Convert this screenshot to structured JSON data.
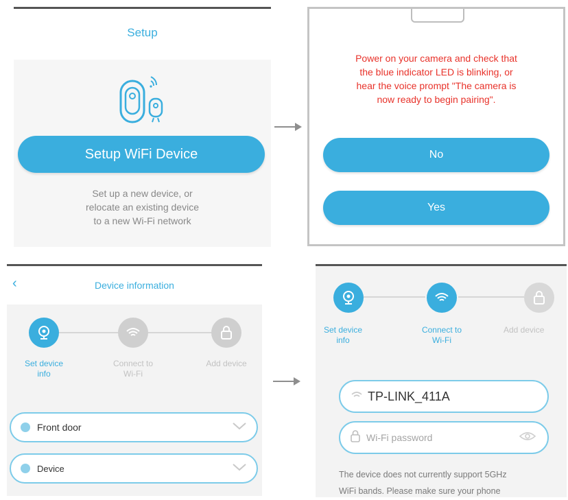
{
  "colors": {
    "accent": "#3aaede",
    "warning_text": "#e8322a",
    "step_inactive": "#cfcfcf"
  },
  "panel_setup": {
    "title": "Setup",
    "button_label": "Setup WiFi Device",
    "description_lines": [
      "Set up a new device, or",
      "relocate an existing device",
      "to a new Wi-Fi network"
    ],
    "icons": [
      "camera-icon",
      "wifi-signal-icon"
    ]
  },
  "panel_confirm": {
    "message_lines": [
      "Power on your camera and check that",
      "the blue indicator LED is blinking, or",
      "hear the voice prompt \"The camera is",
      "now ready to begin pairing\"."
    ],
    "no_label": "No",
    "yes_label": "Yes"
  },
  "panel_device_info": {
    "title": "Device information",
    "steps": [
      {
        "label_lines": [
          "Set device",
          "info"
        ],
        "icon": "camera-icon"
      },
      {
        "label_lines": [
          "Connect to",
          "Wi-Fi"
        ],
        "icon": "wifi-icon"
      },
      {
        "label": "Add device",
        "icon": "lock-icon"
      }
    ],
    "location_value": "Front door",
    "device_value": "Device"
  },
  "panel_wifi": {
    "steps": [
      {
        "label_lines": [
          "Set device",
          "info"
        ],
        "icon": "camera-icon"
      },
      {
        "label_lines": [
          "Connect to",
          "Wi-Fi"
        ],
        "icon": "wifi-icon"
      },
      {
        "label": "Add device",
        "icon": "lock-icon"
      }
    ],
    "ssid_value": "TP-LINK_411A",
    "password_placeholder": "Wi-Fi password",
    "note_lines": [
      "The device does not currently support 5GHz",
      "WiFi bands. Please make sure your phone"
    ]
  }
}
